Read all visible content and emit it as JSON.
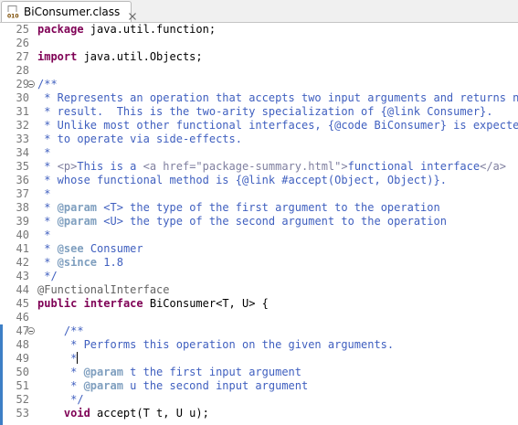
{
  "tab": {
    "label": "BiConsumer.class",
    "icon": "class-file-icon",
    "close_icon": "close-icon"
  },
  "colors": {
    "keyword": "#7f0055",
    "javadoc": "#3f5fbf",
    "javadoc_tag": "#7f9fbf",
    "html_tag": "#7f7f9f",
    "annotation": "#646464",
    "line_number": "#787878",
    "change_marker": "#3d7fc6"
  },
  "lines": [
    {
      "n": "25",
      "fold": false,
      "segs": [
        {
          "c": "kw",
          "t": "package"
        },
        {
          "c": "plain",
          "t": " java.util.function;"
        }
      ]
    },
    {
      "n": "26",
      "fold": false,
      "segs": []
    },
    {
      "n": "27",
      "fold": false,
      "segs": [
        {
          "c": "kw",
          "t": "import"
        },
        {
          "c": "plain",
          "t": " java.util.Objects;"
        }
      ]
    },
    {
      "n": "28",
      "fold": false,
      "segs": []
    },
    {
      "n": "29",
      "fold": true,
      "segs": [
        {
          "c": "jd",
          "t": "/**"
        }
      ]
    },
    {
      "n": "30",
      "fold": false,
      "segs": [
        {
          "c": "jd",
          "t": " * Represents an operation that accepts two input arguments and returns no"
        }
      ]
    },
    {
      "n": "31",
      "fold": false,
      "segs": [
        {
          "c": "jd",
          "t": " * result.  This is the two-arity specialization of {@link Consumer}."
        }
      ]
    },
    {
      "n": "32",
      "fold": false,
      "segs": [
        {
          "c": "jd",
          "t": " * Unlike most other functional interfaces, {@code BiConsumer} is expected"
        }
      ]
    },
    {
      "n": "33",
      "fold": false,
      "segs": [
        {
          "c": "jd",
          "t": " * to operate via side-effects."
        }
      ]
    },
    {
      "n": "34",
      "fold": false,
      "segs": [
        {
          "c": "jd",
          "t": " *"
        }
      ]
    },
    {
      "n": "35",
      "fold": false,
      "segs": [
        {
          "c": "jd",
          "t": " * "
        },
        {
          "c": "ht",
          "t": "<p>"
        },
        {
          "c": "jd",
          "t": "This is a "
        },
        {
          "c": "ht",
          "t": "<a href=\"package-summary.html\">"
        },
        {
          "c": "jd",
          "t": "functional interface"
        },
        {
          "c": "ht",
          "t": "</a>"
        }
      ]
    },
    {
      "n": "36",
      "fold": false,
      "segs": [
        {
          "c": "jd",
          "t": " * whose functional method is {@link #accept(Object, Object)}."
        }
      ]
    },
    {
      "n": "37",
      "fold": false,
      "segs": [
        {
          "c": "jd",
          "t": " *"
        }
      ]
    },
    {
      "n": "38",
      "fold": false,
      "segs": [
        {
          "c": "jd",
          "t": " * "
        },
        {
          "c": "jt",
          "t": "@param"
        },
        {
          "c": "jd",
          "t": " <T> the type of the first argument to the operation"
        }
      ]
    },
    {
      "n": "39",
      "fold": false,
      "segs": [
        {
          "c": "jd",
          "t": " * "
        },
        {
          "c": "jt",
          "t": "@param"
        },
        {
          "c": "jd",
          "t": " <U> the type of the second argument to the operation"
        }
      ]
    },
    {
      "n": "40",
      "fold": false,
      "segs": [
        {
          "c": "jd",
          "t": " *"
        }
      ]
    },
    {
      "n": "41",
      "fold": false,
      "segs": [
        {
          "c": "jd",
          "t": " * "
        },
        {
          "c": "jt",
          "t": "@see"
        },
        {
          "c": "jd",
          "t": " Consumer"
        }
      ]
    },
    {
      "n": "42",
      "fold": false,
      "segs": [
        {
          "c": "jd",
          "t": " * "
        },
        {
          "c": "jt",
          "t": "@since"
        },
        {
          "c": "jd",
          "t": " 1.8"
        }
      ]
    },
    {
      "n": "43",
      "fold": false,
      "segs": [
        {
          "c": "jd",
          "t": " */"
        }
      ]
    },
    {
      "n": "44",
      "fold": false,
      "segs": [
        {
          "c": "ann",
          "t": "@FunctionalInterface"
        }
      ]
    },
    {
      "n": "45",
      "fold": false,
      "segs": [
        {
          "c": "kw",
          "t": "public"
        },
        {
          "c": "plain",
          "t": " "
        },
        {
          "c": "kw",
          "t": "interface"
        },
        {
          "c": "plain",
          "t": " BiConsumer<T, U> {"
        }
      ]
    },
    {
      "n": "46",
      "fold": false,
      "segs": []
    },
    {
      "n": "47",
      "fold": true,
      "segs": [
        {
          "c": "jd",
          "t": "    /**"
        }
      ]
    },
    {
      "n": "48",
      "fold": false,
      "segs": [
        {
          "c": "jd",
          "t": "     * Performs this operation on the given arguments."
        }
      ]
    },
    {
      "n": "49",
      "fold": false,
      "cursor": true,
      "segs": [
        {
          "c": "jd",
          "t": "     *"
        }
      ]
    },
    {
      "n": "50",
      "fold": false,
      "segs": [
        {
          "c": "jd",
          "t": "     * "
        },
        {
          "c": "jt",
          "t": "@param"
        },
        {
          "c": "jd",
          "t": " t the first input argument"
        }
      ]
    },
    {
      "n": "51",
      "fold": false,
      "segs": [
        {
          "c": "jd",
          "t": "     * "
        },
        {
          "c": "jt",
          "t": "@param"
        },
        {
          "c": "jd",
          "t": " u the second input argument"
        }
      ]
    },
    {
      "n": "52",
      "fold": false,
      "segs": [
        {
          "c": "jd",
          "t": "     */"
        }
      ]
    },
    {
      "n": "53",
      "fold": false,
      "segs": [
        {
          "c": "plain",
          "t": "    "
        },
        {
          "c": "kw",
          "t": "void"
        },
        {
          "c": "plain",
          "t": " accept(T t, U u);"
        }
      ]
    }
  ]
}
